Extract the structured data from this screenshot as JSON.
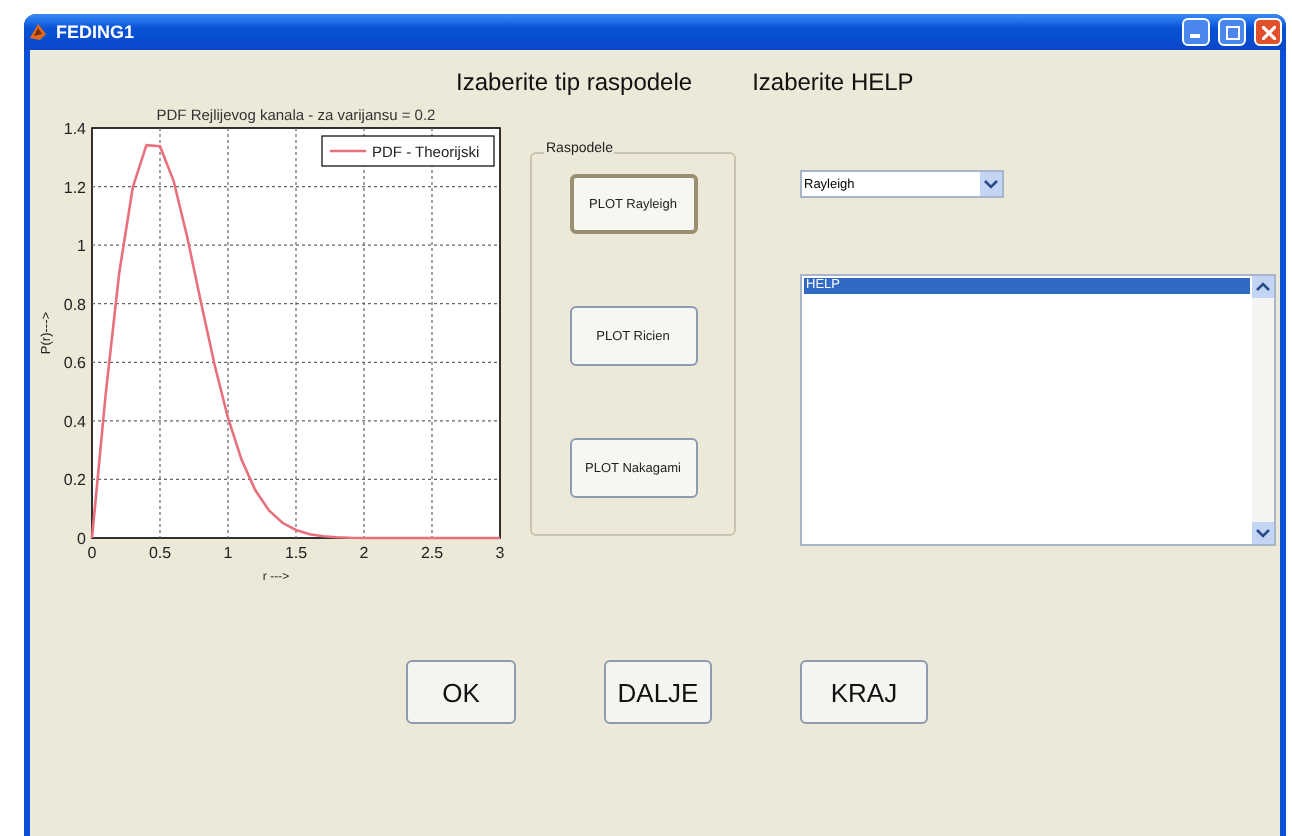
{
  "window": {
    "title": "FEDING1"
  },
  "headings": [
    "Izaberite tip raspodele",
    "Izaberite HELP"
  ],
  "plot": {
    "chart_data": {
      "type": "line",
      "title": "PDF Rejlijevog kanala - za varijansu = 0.2",
      "xlabel": "r --->",
      "ylabel": "P(r)--->",
      "x": [
        0,
        0.1,
        0.2,
        0.3,
        0.4,
        0.5,
        0.6,
        0.7,
        0.8,
        0.9,
        1,
        1.1,
        1.2,
        1.3,
        1.4,
        1.5,
        1.6,
        1.7,
        1.8,
        1.9,
        2,
        2.2,
        2.4,
        2.6,
        2.8,
        3
      ],
      "series": [
        {
          "name": "PDF - Theorijski",
          "color": "#e8707c",
          "values": [
            0,
            0.488,
            0.905,
            1.198,
            1.341,
            1.338,
            1.22,
            1.028,
            0.808,
            0.594,
            0.41,
            0.267,
            0.164,
            0.095,
            0.052,
            0.027,
            0.013,
            0.006,
            0.003,
            0.001,
            0,
            0,
            0,
            0,
            0,
            0
          ]
        }
      ],
      "grid": true,
      "xlim": [
        0,
        3
      ],
      "ylim": [
        0,
        1.4
      ],
      "xticks": [
        0,
        0.5,
        1,
        1.5,
        2,
        2.5,
        3
      ],
      "yticks": [
        0,
        0.2,
        0.4,
        0.6,
        0.8,
        1,
        1.2,
        1.4
      ]
    }
  },
  "group": {
    "title": "Raspodele",
    "buttons": [
      {
        "label": "PLOT Rayleigh",
        "focused": true
      },
      {
        "label": "PLOT Ricien",
        "focused": false
      },
      {
        "label": "PLOT Nakagami",
        "focused": false
      }
    ]
  },
  "dropdown": {
    "value": "Rayleigh"
  },
  "help_list": {
    "items": [
      {
        "label": "HELP",
        "selected": true
      }
    ]
  },
  "buttons": [
    "OK",
    "DALJE",
    "KRAJ"
  ]
}
